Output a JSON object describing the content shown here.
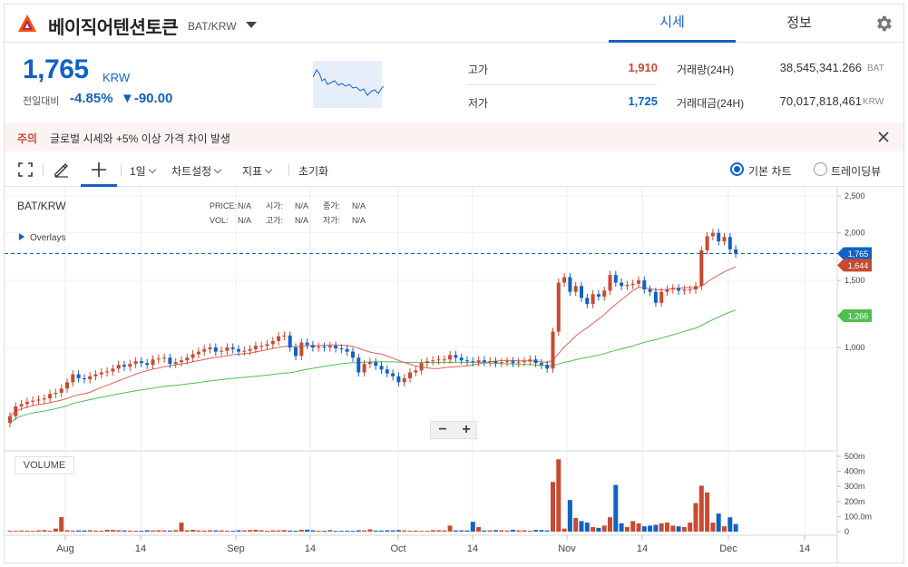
{
  "header": {
    "coin_name": "베이직어텐션토큰",
    "pair": "BAT/KRW",
    "tabs": [
      "시세",
      "정보"
    ]
  },
  "price": {
    "current": "1,765",
    "unit": "KRW",
    "prev_label": "전일대비",
    "change_rate": "-4.85%",
    "change_amount": "▼-90.00"
  },
  "stats": {
    "high_label": "고가",
    "high_value": "1,910",
    "low_label": "저가",
    "low_value": "1,725",
    "volume_label": "거래량(24H)",
    "volume_value": "38,545,341.266",
    "volume_unit": "BAT",
    "amount_label": "거래대금(24H)",
    "amount_value": "70,017,818,461",
    "amount_unit": "KRW"
  },
  "notice": {
    "tag": "주의",
    "text": "글로벌 시세와 +5% 이상 가격 차이 발생"
  },
  "toolbar": {
    "interval": "1일",
    "chart_settings": "차트설정",
    "indicators": "지표",
    "reset": "초기화",
    "basic_chart": "기본 차트",
    "trading_view": "트레이딩뷰"
  },
  "legend": {
    "symbol": "BAT/KRW",
    "price_label": "PRICE:",
    "price_val": "N/A",
    "open_label": "시가:",
    "open_val": "N/A",
    "close_label": "종가:",
    "close_val": "N/A",
    "vol_label": "VOL:",
    "vol_val": "N/A",
    "high_label": "고가:",
    "high_val": "N/A",
    "low_label": "저가:",
    "low_val": "N/A",
    "overlays": "Overlays",
    "volume_title": "VOLUME"
  },
  "colors": {
    "up": "#c84a31",
    "down": "#1261c4",
    "ma_short": "#e0605a",
    "ma_long": "#4fbf4f"
  },
  "chart_data": {
    "type": "candlestick",
    "price_axis_ticks": [
      "2,500",
      "2,000",
      "1,500",
      "1,000"
    ],
    "price_axis_values": [
      2500,
      2000,
      1500,
      1000
    ],
    "volume_axis_ticks": [
      "500m",
      "400m",
      "300m",
      "200m",
      "100.0m",
      "0"
    ],
    "volume_axis_values": [
      500,
      400,
      300,
      200,
      100,
      0
    ],
    "x_ticks": [
      "Aug",
      "14",
      "Sep",
      "14",
      "Oct",
      "14",
      "Nov",
      "14",
      "Dec",
      "14"
    ],
    "price_labels": [
      {
        "value": "1,765",
        "price": 1765,
        "kind": "current"
      },
      {
        "value": "1,644",
        "price": 1644,
        "kind": "ma_short"
      },
      {
        "value": "1,266",
        "price": 1266,
        "kind": "ma_long"
      }
    ],
    "ylim": [
      700,
      2550
    ],
    "close": [
      660,
      700,
      710,
      720,
      725,
      730,
      735,
      755,
      760,
      780,
      810,
      850,
      830,
      825,
      840,
      850,
      860,
      865,
      880,
      900,
      890,
      905,
      920,
      910,
      900,
      930,
      935,
      940,
      905,
      915,
      925,
      940,
      960,
      975,
      990,
      1000,
      975,
      980,
      1000,
      990,
      975,
      980,
      990,
      1010,
      1010,
      1020,
      1040,
      1070,
      1075,
      1000,
      950,
      1030,
      1015,
      1000,
      1005,
      1000,
      1010,
      995,
      990,
      975,
      940,
      860,
      905,
      915,
      895,
      875,
      855,
      840,
      810,
      830,
      860,
      870,
      910,
      920,
      925,
      930,
      930,
      955,
      940,
      925,
      920,
      915,
      925,
      915,
      920,
      910,
      915,
      920,
      910,
      915,
      920,
      930,
      910,
      900,
      880,
      1100,
      1480,
      1530,
      1400,
      1450,
      1350,
      1300,
      1380,
      1360,
      1410,
      1550,
      1480,
      1450,
      1460,
      1470,
      1500,
      1420,
      1400,
      1310,
      1400,
      1420,
      1430,
      1410,
      1420,
      1420,
      1450,
      1800,
      1960,
      2000,
      1900,
      1950,
      1810,
      1765
    ],
    "volume": [
      6,
      5,
      7,
      6,
      5,
      8,
      10,
      6,
      20,
      96,
      9,
      7,
      8,
      8,
      9,
      7,
      6,
      12,
      11,
      9,
      8,
      7,
      6,
      6,
      9,
      8,
      9,
      8,
      7,
      10,
      60,
      9,
      12,
      8,
      7,
      9,
      8,
      8,
      6,
      5,
      9,
      8,
      10,
      12,
      9,
      6,
      8,
      8,
      10,
      7,
      6,
      12,
      13,
      9,
      6,
      5,
      10,
      5,
      5,
      6,
      5,
      9,
      8,
      15,
      7,
      7,
      9,
      8,
      10,
      8,
      6,
      7,
      5,
      5,
      10,
      9,
      8,
      40,
      8,
      8,
      8,
      65,
      30,
      8,
      8,
      10,
      9,
      7,
      12,
      8,
      9,
      6,
      11,
      10,
      8,
      330,
      480,
      20,
      210,
      90,
      70,
      60,
      30,
      25,
      40,
      95,
      310,
      55,
      30,
      70,
      55,
      35,
      40,
      45,
      55,
      60,
      40,
      35,
      30,
      60,
      190,
      305,
      260,
      60,
      120,
      35,
      95,
      50
    ]
  }
}
